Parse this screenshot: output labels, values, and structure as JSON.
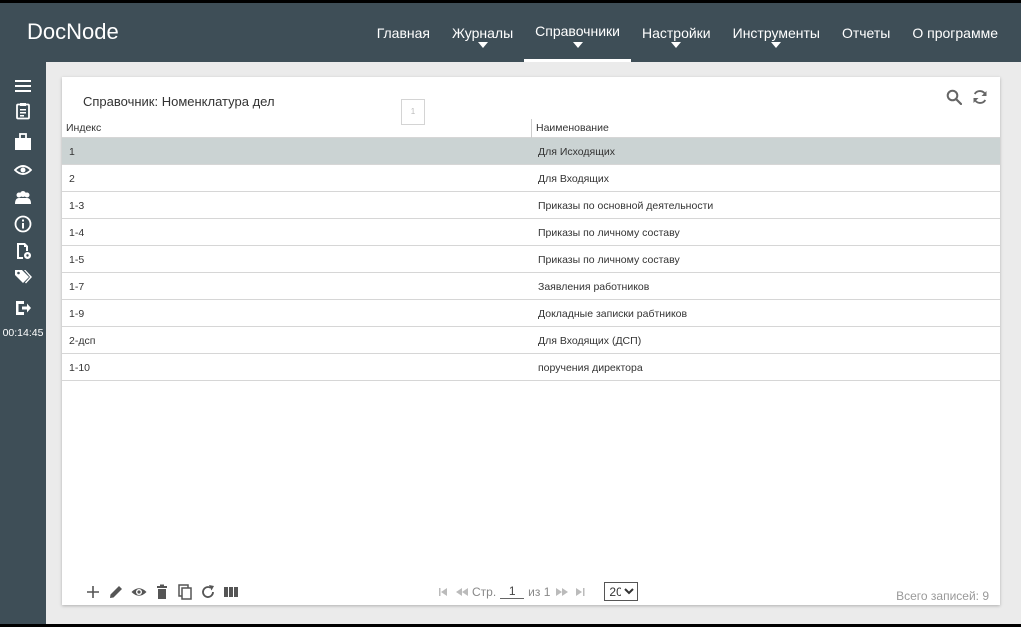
{
  "app": {
    "logo": "DocNode"
  },
  "nav": [
    {
      "label": "Главная",
      "dropdown": false,
      "active": false
    },
    {
      "label": "Журналы",
      "dropdown": true,
      "active": false
    },
    {
      "label": "Справочники",
      "dropdown": true,
      "active": true
    },
    {
      "label": "Настройки",
      "dropdown": true,
      "active": false
    },
    {
      "label": "Инструменты",
      "dropdown": true,
      "active": false
    },
    {
      "label": "Отчеты",
      "dropdown": false,
      "active": false
    },
    {
      "label": "О программе",
      "dropdown": false,
      "active": false
    }
  ],
  "sidebar": {
    "icons": [
      "menu-icon",
      "clipboard-icon",
      "briefcase-icon",
      "eye-icon",
      "users-icon",
      "info-icon",
      "document-settings-icon",
      "tags-icon",
      "logout-icon"
    ],
    "clock": "00:14:45"
  },
  "panel": {
    "title": "Справочник: Номенклатура дел",
    "page_marker": "1",
    "tools": [
      "search-icon",
      "refresh-icon"
    ]
  },
  "table": {
    "columns": [
      "Индекс",
      "Наименование"
    ],
    "rows": [
      {
        "index": "1",
        "name": "Для Исходящих",
        "selected": true
      },
      {
        "index": "2",
        "name": "Для Входящих",
        "selected": false
      },
      {
        "index": "1-3",
        "name": "Приказы по основной деятельности",
        "selected": false
      },
      {
        "index": "1-4",
        "name": "Приказы по личному составу",
        "selected": false
      },
      {
        "index": "1-5",
        "name": "Приказы по личному составу",
        "selected": false
      },
      {
        "index": "1-7",
        "name": "Заявления работников",
        "selected": false
      },
      {
        "index": "1-9",
        "name": "Докладные записки рабтников",
        "selected": false
      },
      {
        "index": "2-дсп",
        "name": "Для Входящих (ДСП)",
        "selected": false
      },
      {
        "index": "1-10",
        "name": "поручения директора",
        "selected": false
      }
    ]
  },
  "footer": {
    "actions": [
      "add-icon",
      "edit-icon",
      "view-icon",
      "delete-icon",
      "copy-icon",
      "reload-icon",
      "columns-icon"
    ],
    "pager": {
      "page_label": "Стр.",
      "page_value": "1",
      "of_label": "из 1",
      "page_size": "20"
    },
    "total": "Всего записей: 9"
  }
}
